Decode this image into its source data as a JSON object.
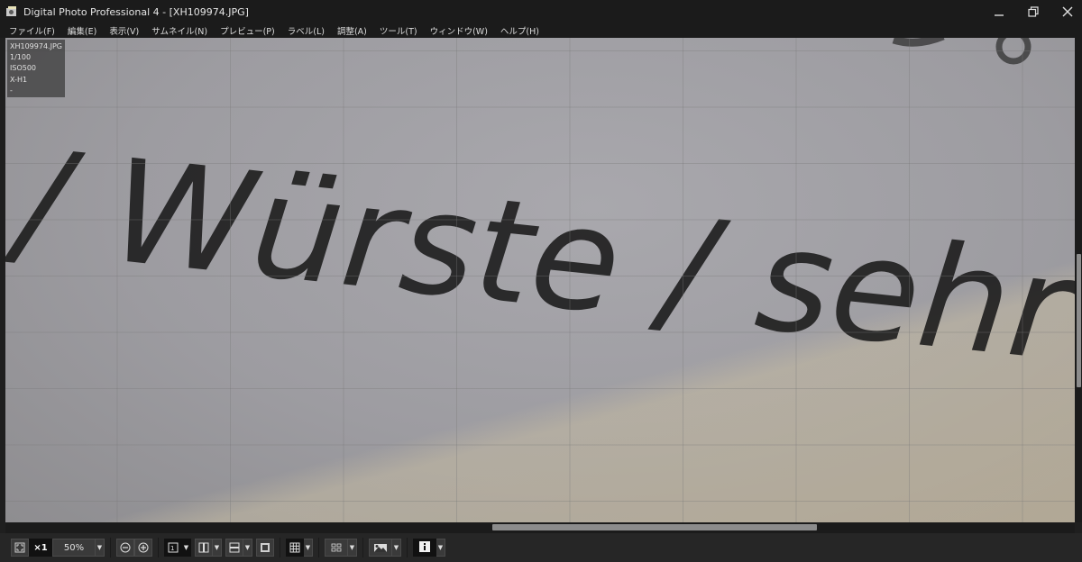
{
  "window": {
    "title": "Digital Photo Professional 4 - [XH109974.JPG]",
    "controls": [
      "minimize-icon",
      "restore-icon",
      "close-icon"
    ]
  },
  "menu": [
    {
      "label": "ファイル(F)"
    },
    {
      "label": "編集(E)"
    },
    {
      "label": "表示(V)"
    },
    {
      "label": "サムネイル(N)"
    },
    {
      "label": "プレビュー(P)"
    },
    {
      "label": "ラベル(L)"
    },
    {
      "label": "調整(A)"
    },
    {
      "label": "ツール(T)"
    },
    {
      "label": "ウィンドウ(W)"
    },
    {
      "label": "ヘルプ(H)"
    }
  ],
  "info": {
    "filename": "XH109974.JPG",
    "shutter": "1/100",
    "iso": "ISO500",
    "camera": "X-H1",
    "extra": "-"
  },
  "photo": {
    "text": "/ Würste / sehr"
  },
  "toolbar": {
    "fit_icon": "fit-screen-icon",
    "zoom_1x": "×1",
    "zoom_value": "50%",
    "zoom_out_icon": "zoom-out-icon",
    "zoom_in_icon": "zoom-in-icon",
    "layout_icons": [
      "single-view-icon",
      "compare-vertical-icon",
      "compare-horizontal-icon",
      "thumbnail-layout-icon"
    ],
    "grid_icon": "grid-icon",
    "af_point_icon": "af-point-icon",
    "highlight_icon": "highlight-warning-icon",
    "info_icon": "info-icon"
  },
  "colors": {
    "accent_dark": "#111111",
    "background": "#1f1f1f"
  }
}
